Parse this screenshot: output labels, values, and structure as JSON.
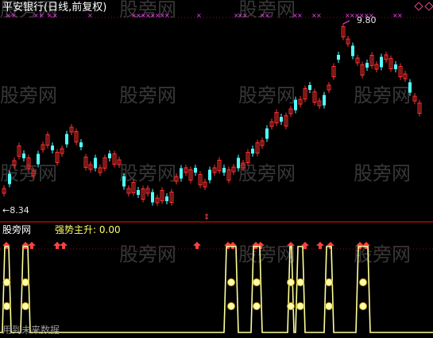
{
  "header": {
    "stock_title": "平安银行(日线,前复权)",
    "indicator_source": "股旁网",
    "indicator_label": "强势主升:",
    "indicator_value": "0.00"
  },
  "price_labels": {
    "low": "←8.34",
    "high": "9.80"
  },
  "watermark_text": "股旁网",
  "footer_text": "用到未来数据",
  "colors": {
    "background": "#000000",
    "up_candle": "#ff3030",
    "down_candle": "#54ffff",
    "divider": "#c01010",
    "signal_line": "#ffff99",
    "arrow": "#ff4040",
    "marker_cross": "#ff40ff"
  },
  "chart_data": {
    "type": "candlestick",
    "title": "平安银行(日线,前复权)",
    "low_marker": 8.34,
    "high_marker": 9.8,
    "indicator": {
      "name": "强势主升",
      "current_value": 0.0,
      "signal_spike_count": 12
    }
  }
}
